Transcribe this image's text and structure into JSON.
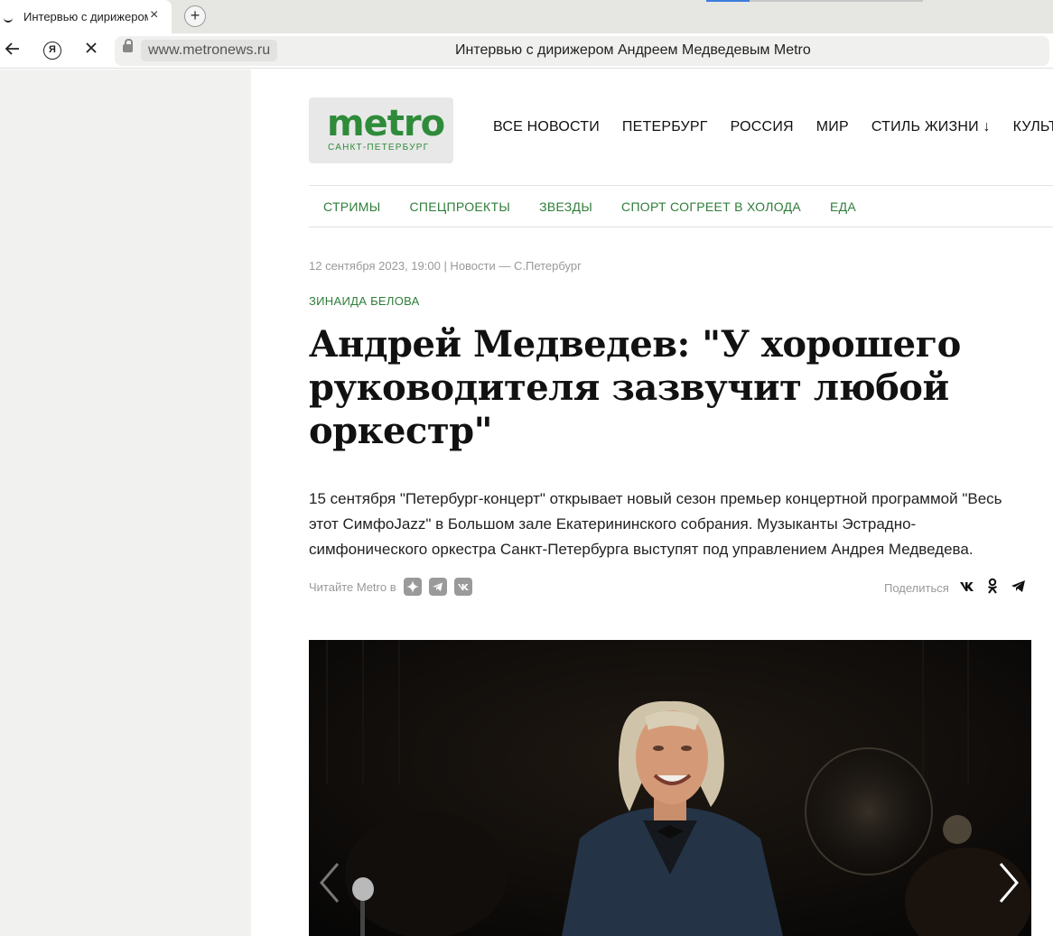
{
  "browser": {
    "tab_title": "Интервью с дирижером Андреем Медведевым Metro",
    "tab_close": "×",
    "new_tab": "+",
    "url": "www.metronews.ru",
    "page_title": "Интервью с дирижером Андреем Медведевым Metro",
    "yandex_letter": "Я"
  },
  "site": {
    "logo_word": "metro",
    "logo_city": "САНКТ-ПЕТЕРБУРГ",
    "main_nav": [
      "ВСЕ НОВОСТИ",
      "ПЕТЕРБУРГ",
      "РОССИЯ",
      "МИР",
      "СТИЛЬ ЖИЗНИ ↓",
      "КУЛЬТУРА"
    ],
    "sub_nav": [
      "СТРИМЫ",
      "СПЕЦПРОЕКТЫ",
      "ЗВЕЗДЫ",
      "СПОРТ СОГРЕЕТ В ХОЛОДА",
      "ЕДА"
    ]
  },
  "article": {
    "meta": "12 сентября 2023, 19:00 | Новости — С.Петербург",
    "author": "ЗИНАИДА БЕЛОВА",
    "headline": "Андрей Медведев: \"У хорошего руководителя зазвучит любой оркестр\"",
    "lead": "15 сентября \"Петербург-концерт\" открывает новый сезон премьер концертной программой \"Весь этот СимфоJazz\" в Большом зале Екатерининского собрания. Музыканты Эстрадно-симфонического оркестра Санкт-Петербурга выступят под управлением Андрея Медведева.",
    "read_in_label": "Читайте Metro в",
    "share_label": "Поделиться"
  },
  "colors": {
    "brand_green": "#2e8b3a",
    "link_green": "#2e7d3a"
  }
}
